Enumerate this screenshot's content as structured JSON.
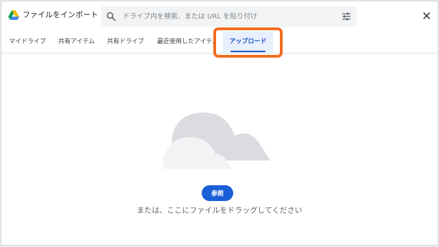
{
  "header": {
    "title": "ファイルをインポート",
    "logo_icon": "google-drive-logo-icon",
    "close_icon": "close-icon"
  },
  "search": {
    "placeholder": "ドライブ内を検索、または URL を貼り付け",
    "value": "",
    "search_icon": "search-icon",
    "filter_icon": "filter-options-icon"
  },
  "tabs": [
    {
      "label": "マイドライブ",
      "active": false
    },
    {
      "label": "共有アイテム",
      "active": false
    },
    {
      "label": "共有ドライブ",
      "active": false
    },
    {
      "label": "最近使用したアイテム",
      "active": false
    },
    {
      "label": "アップロード",
      "active": true
    }
  ],
  "upload": {
    "browse_label": "参照",
    "drag_text": "または、ここにファイルをドラッグしてください",
    "illustration_icon": "cloud-icon"
  },
  "colors": {
    "accent": "#1a56c4",
    "button": "#1a5fd6",
    "highlight": "#f26b1d",
    "cloud": "#dadce0"
  }
}
